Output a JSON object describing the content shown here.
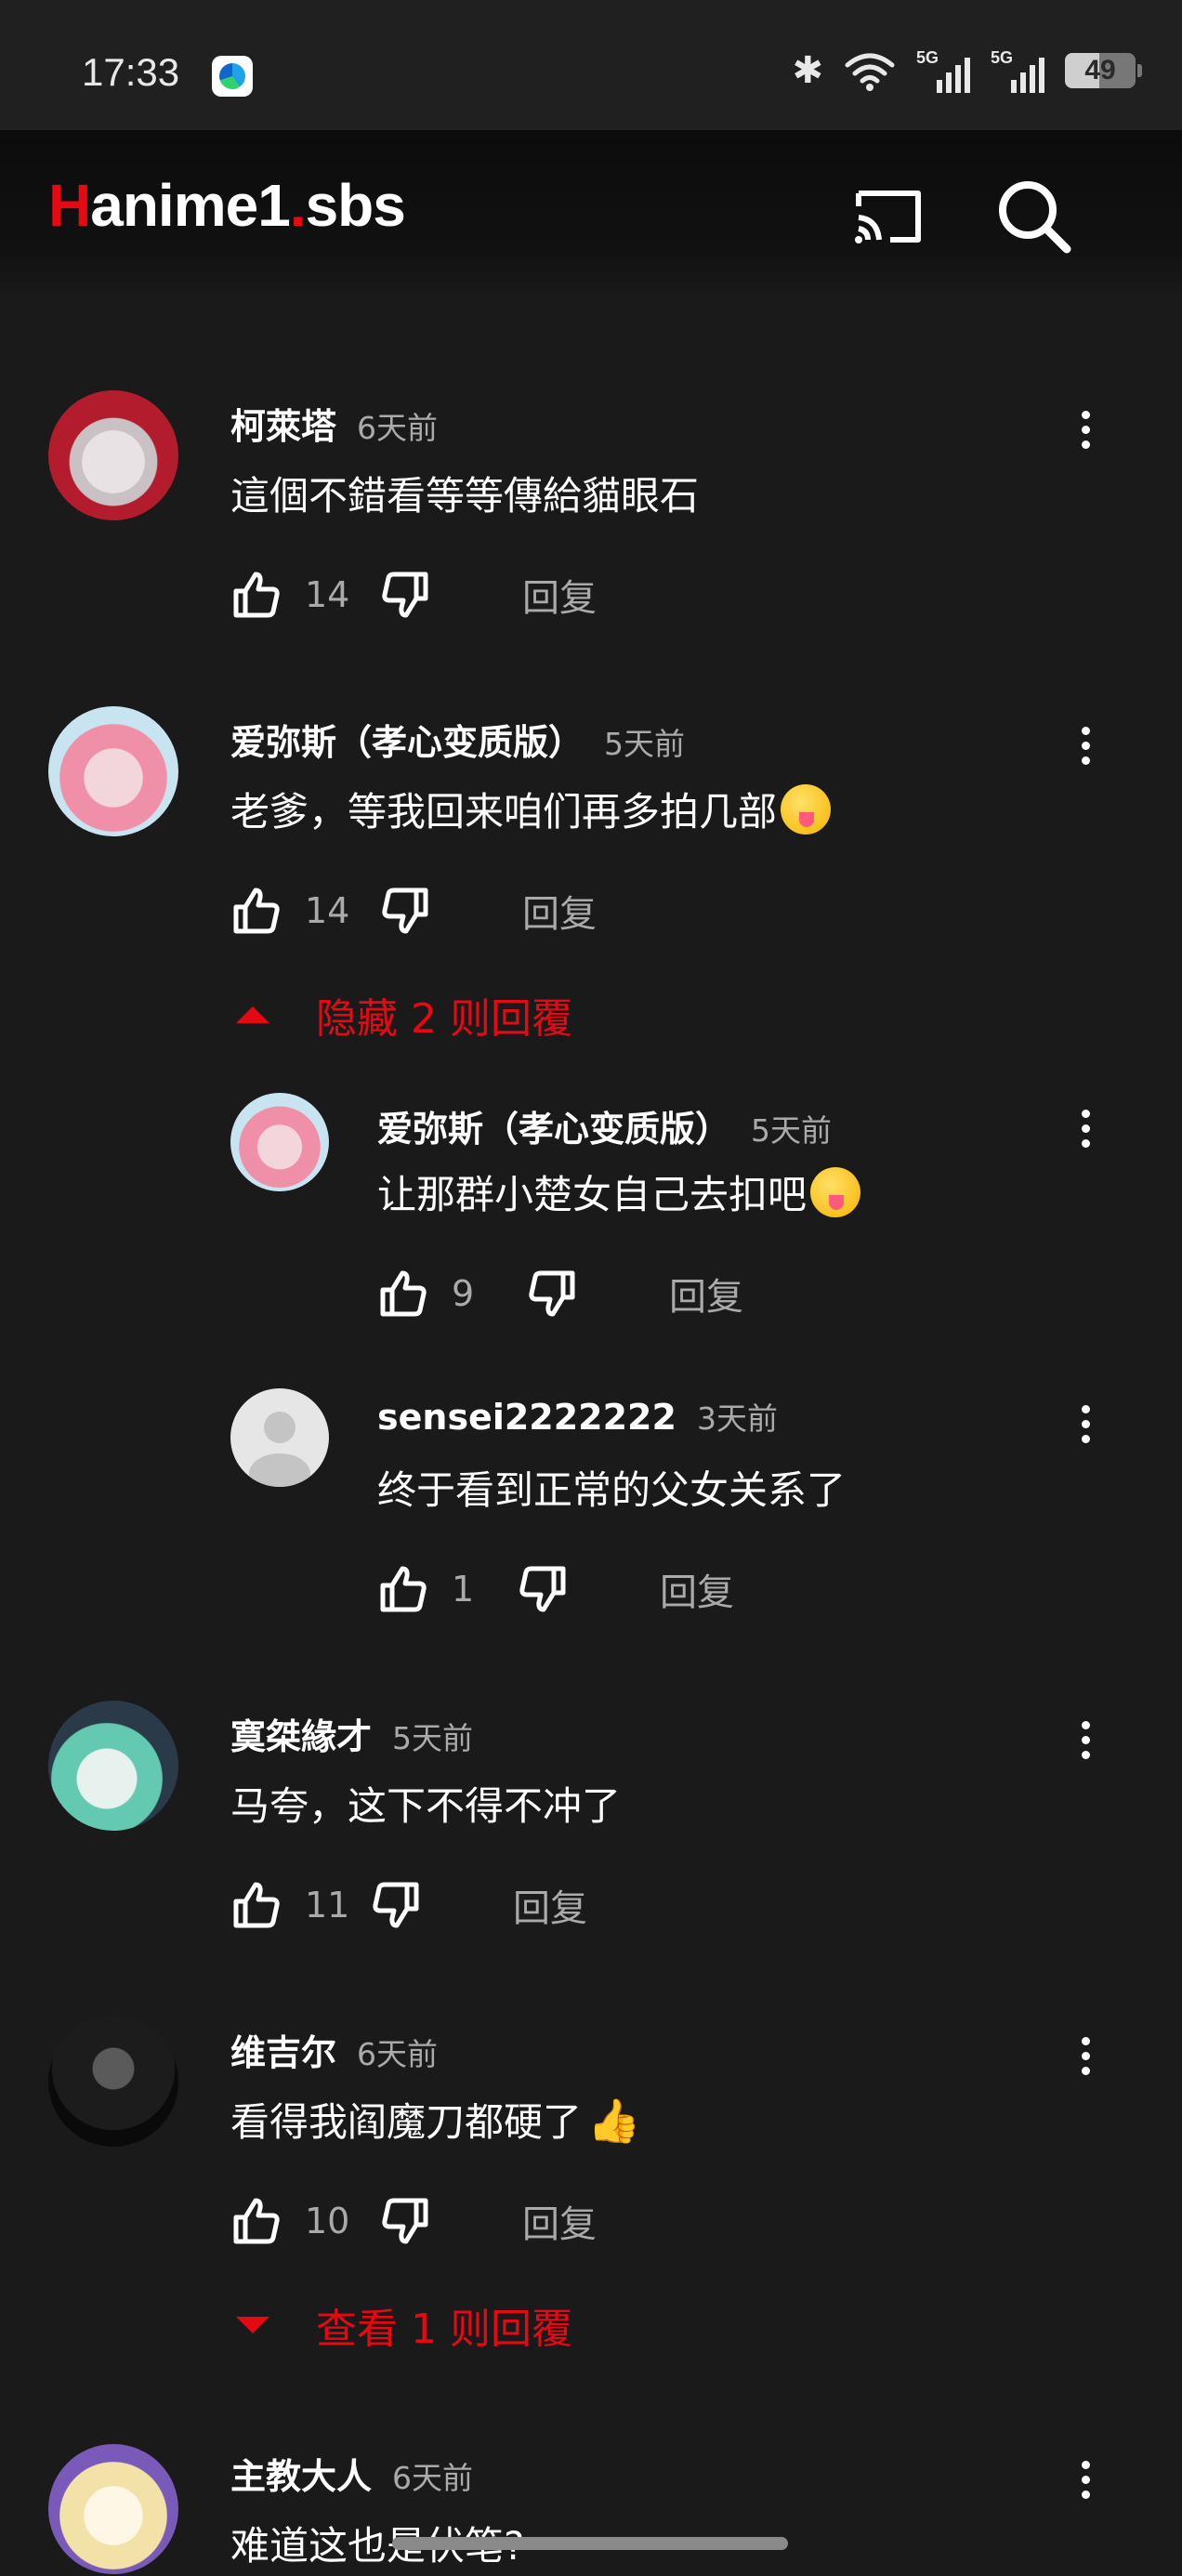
{
  "status": {
    "time": "17:33",
    "signal1": "5G",
    "signal2": "5G",
    "battery": "49"
  },
  "app": {
    "logo_h": "H",
    "logo_rest1": "anime1",
    "logo_dot": ".",
    "logo_rest2": "sbs"
  },
  "comments": [
    {
      "user": "柯萊塔",
      "time": "6天前",
      "text": "這個不錯看等等傳給貓眼石",
      "likes": "14",
      "reply": "回复"
    },
    {
      "user": "爱弥斯（孝心变质版）",
      "time": "5天前",
      "text": "老爹，等我回来咱们再多拍几部",
      "likes": "14",
      "reply": "回复",
      "toggle": "隐藏 2 则回覆",
      "replies": [
        {
          "user": "爱弥斯（孝心变质版）",
          "time": "5天前",
          "text": "让那群小楚女自己去扣吧",
          "likes": "9",
          "reply": "回复"
        },
        {
          "user": "sensei2222222",
          "time": "3天前",
          "text": "终于看到正常的父女关系了",
          "likes": "1",
          "reply": "回复"
        }
      ]
    },
    {
      "user": "寞桀緣才",
      "time": "5天前",
      "text": "马夸，这下不得不冲了",
      "likes": "11",
      "reply": "回复"
    },
    {
      "user": "维吉尔",
      "time": "6天前",
      "text": "看得我阎魔刀都硬了",
      "likes": "10",
      "reply": "回复",
      "toggle": "查看 1 则回覆"
    },
    {
      "user": "主教大人",
      "time": "6天前",
      "text": "难道这也是伏笔?"
    }
  ],
  "colors": {
    "accent": "#e50914",
    "background": "#1a1a1a",
    "muted": "#aaaaaa"
  }
}
